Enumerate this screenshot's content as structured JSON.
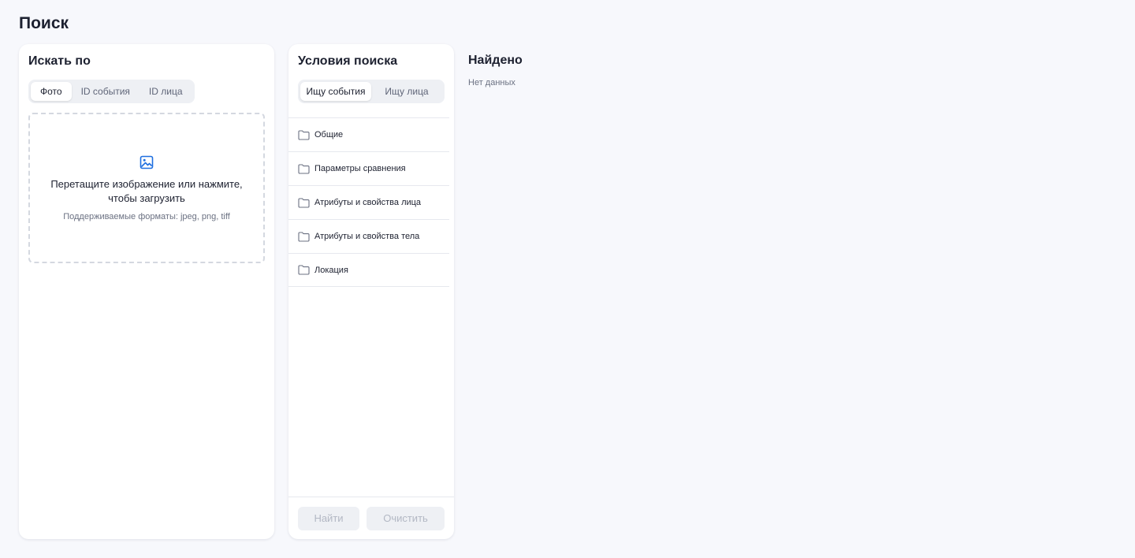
{
  "page": {
    "title": "Поиск"
  },
  "search_by": {
    "title": "Искать по",
    "tabs": [
      {
        "label": "Фото",
        "active": true
      },
      {
        "label": "ID события",
        "active": false
      },
      {
        "label": "ID лица",
        "active": false
      }
    ],
    "dropzone": {
      "icon": "image-icon",
      "text": "Перетащите изображение или нажмите, чтобы загрузить",
      "hint": "Поддерживаемые форматы: jpeg, png, tiff"
    }
  },
  "conditions": {
    "title": "Условия поиска",
    "tabs": [
      {
        "label": "Ищу события",
        "active": true
      },
      {
        "label": "Ищу лица",
        "active": false
      }
    ],
    "groups": [
      {
        "label": "Общие",
        "icon": "folder-icon"
      },
      {
        "label": "Параметры сравнения",
        "icon": "folder-icon"
      },
      {
        "label": "Атрибуты и свойства лица",
        "icon": "folder-icon"
      },
      {
        "label": "Атрибуты и свойства тела",
        "icon": "folder-icon"
      },
      {
        "label": "Локация",
        "icon": "folder-icon"
      }
    ],
    "buttons": {
      "find": "Найти",
      "clear": "Очистить"
    }
  },
  "found": {
    "title": "Найдено",
    "empty": "Нет данных"
  },
  "colors": {
    "accent": "#1f6fe0",
    "background": "#f7f8fc",
    "card": "#ffffff"
  }
}
